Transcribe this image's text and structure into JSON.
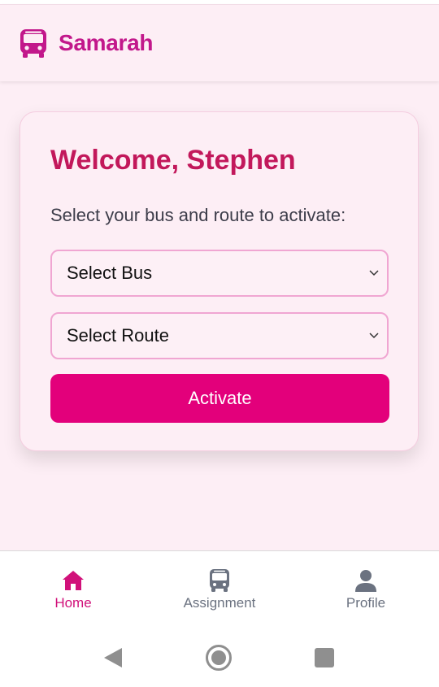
{
  "app": {
    "name": "Samarah",
    "brand_color": "#c2188b",
    "icon": "bus-icon"
  },
  "card": {
    "title": "Welcome, Stephen",
    "subtitle": "Select your bus and route to activate:",
    "bus_select": {
      "value": "Select Bus",
      "icon": "chevron-down-icon"
    },
    "route_select": {
      "value": "Select Route",
      "icon": "chevron-down-icon"
    },
    "activate_label": "Activate",
    "accent_color": "#e3007b"
  },
  "bottom_nav": [
    {
      "label": "Home",
      "icon": "home-icon",
      "active": true
    },
    {
      "label": "Assignment",
      "icon": "bus-icon",
      "active": false
    },
    {
      "label": "Profile",
      "icon": "user-icon",
      "active": false
    }
  ],
  "system_nav": [
    "back-icon",
    "home-circle-icon",
    "recents-icon"
  ]
}
